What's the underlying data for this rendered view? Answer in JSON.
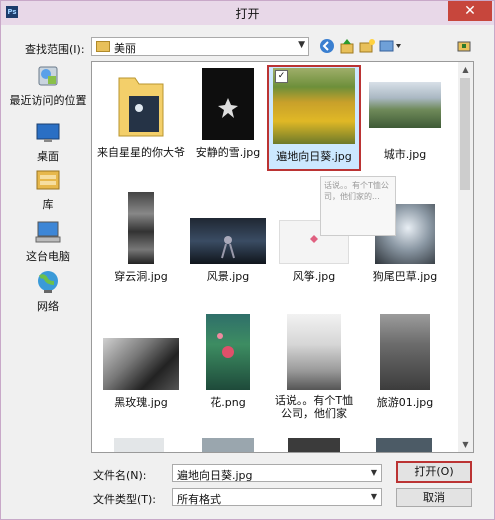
{
  "window": {
    "title": "打开",
    "app_icon": "Ps",
    "close_glyph": "✕"
  },
  "lookin": {
    "label": "查找范围(I):",
    "value": "美丽"
  },
  "toolbar": {
    "back_icon": "back-arrow-icon",
    "up_icon": "up-folder-icon",
    "new_folder_icon": "new-folder-icon",
    "views_icon": "views-menu-icon",
    "extra_icon": "camera-icon"
  },
  "places": [
    {
      "label": "最近访问的位置",
      "icon": "recent-places-icon"
    },
    {
      "label": "桌面",
      "icon": "desktop-icon"
    },
    {
      "label": "库",
      "icon": "libraries-icon"
    },
    {
      "label": "这台电脑",
      "icon": "computer-icon"
    },
    {
      "label": "网络",
      "icon": "network-icon"
    }
  ],
  "files": [
    {
      "name": "来自星星的你大爷",
      "kind": "folder"
    },
    {
      "name": "安静的雪.jpg",
      "kind": "image"
    },
    {
      "name": "遍地向日葵.jpg",
      "kind": "image",
      "selected": true
    },
    {
      "name": "城市.jpg",
      "kind": "image"
    },
    {
      "name": "穿云洞.jpg",
      "kind": "image"
    },
    {
      "name": "风景.jpg",
      "kind": "image"
    },
    {
      "name": "风筝.jpg",
      "kind": "image"
    },
    {
      "name": "狗尾巴草.jpg",
      "kind": "image"
    },
    {
      "name": "黑玫瑰.jpg",
      "kind": "image"
    },
    {
      "name": "花.png",
      "kind": "image"
    },
    {
      "name": "话说。。有个T恤公司，他们家的...",
      "kind": "image"
    },
    {
      "name": "旅游01.jpg",
      "kind": "image"
    }
  ],
  "tooltip": {
    "text": "话说。。有个T恤公司，他们家的..."
  },
  "filename": {
    "label": "文件名(N):",
    "value": "遍地向日葵.jpg"
  },
  "filetype": {
    "label": "文件类型(T):",
    "value": "所有格式"
  },
  "buttons": {
    "open": "打开(O)",
    "cancel": "取消"
  }
}
